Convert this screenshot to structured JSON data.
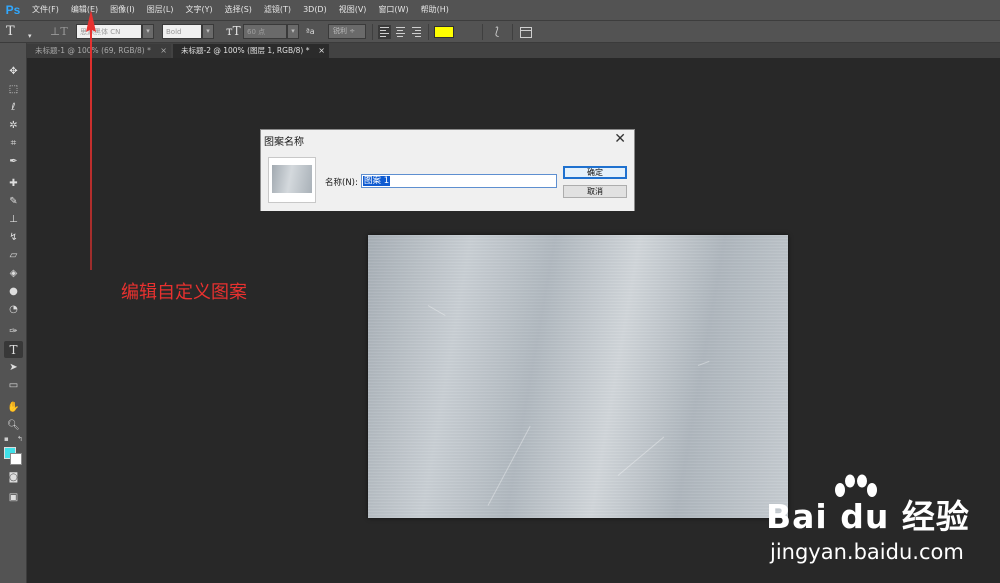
{
  "app": {
    "logo": "Ps",
    "menu": [
      "文件(F)",
      "编辑(E)",
      "图像(I)",
      "图层(L)",
      "文字(Y)",
      "选择(S)",
      "滤镜(T)",
      "3D(D)",
      "视图(V)",
      "窗口(W)",
      "帮助(H)"
    ]
  },
  "options": {
    "font_family": "思源黑体 CN",
    "font_style": "Bold",
    "font_size": "60 点",
    "antialias": "锐利",
    "text_color": "#ffff00"
  },
  "tabs": [
    {
      "label": "未标题-1 @ 100% (69, RGB/8) *",
      "active": false
    },
    {
      "label": "未标题-2 @ 100% (图层 1, RGB/8) *",
      "active": true
    }
  ],
  "colors": {
    "foreground": "#40e0e8",
    "background": "#ffffff"
  },
  "dialog": {
    "title": "图案名称",
    "name_label": "名称(N):",
    "name_value": "图案 1",
    "ok_label": "确定",
    "cancel_label": "取消"
  },
  "annotation": {
    "text": "编辑自定义图案",
    "color": "#e8312f"
  },
  "watermark": {
    "brand": "Bai du 经验",
    "url": "jingyan.baidu.com"
  }
}
